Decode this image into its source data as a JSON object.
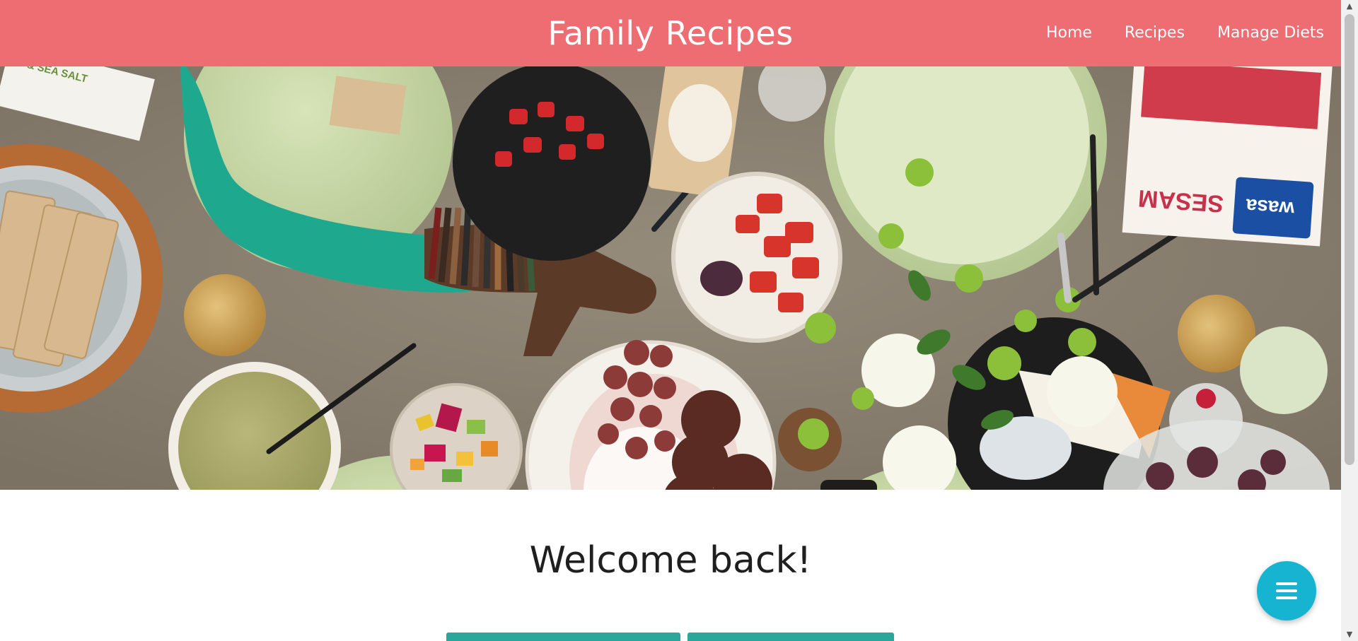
{
  "header": {
    "brand": "Family Recipes",
    "nav": [
      {
        "label": "Home"
      },
      {
        "label": "Recipes"
      },
      {
        "label": "Manage Diets"
      }
    ],
    "color": "#ee6d73"
  },
  "hero": {
    "image_icon": "food-table-photo",
    "product_labels": {
      "cracker_box_left": "& SEA SALT",
      "cracker_box_right": "SESAM",
      "brand_logo": "wasa"
    }
  },
  "main": {
    "welcome": "Welcome back!",
    "button_color": "#2aa69b"
  },
  "fab": {
    "icon": "menu-icon",
    "color": "#17b4d1"
  }
}
